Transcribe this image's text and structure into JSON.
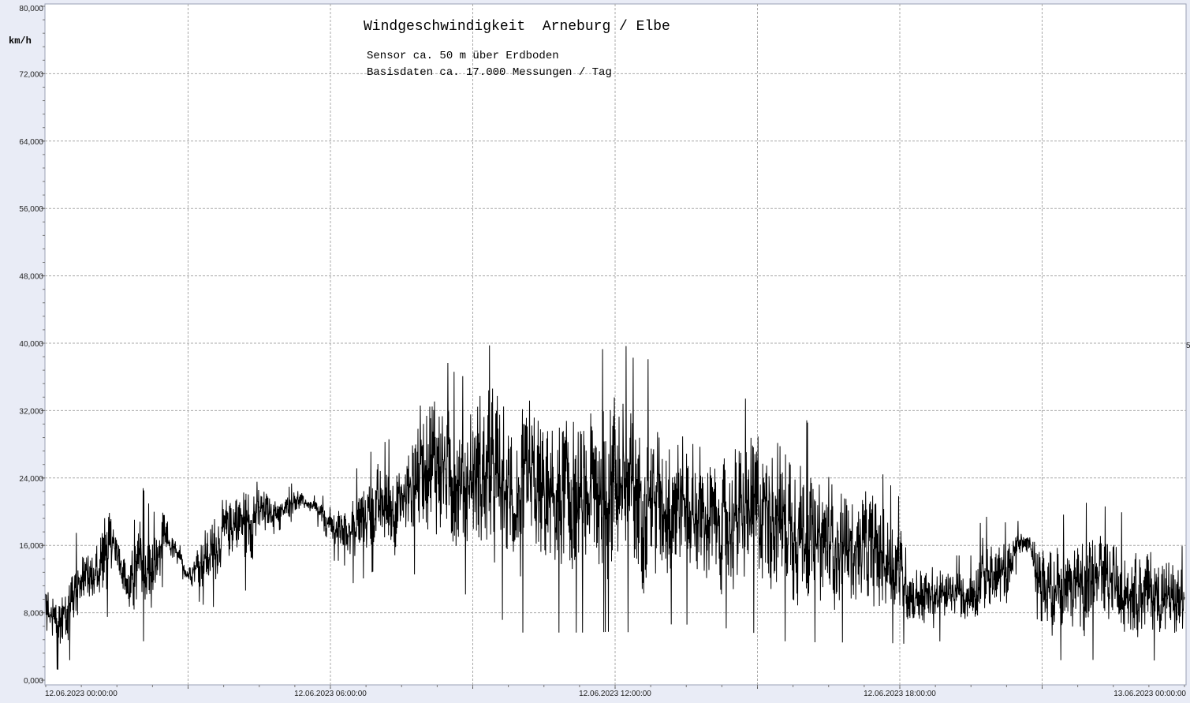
{
  "chart_data": {
    "type": "line",
    "title": "Windgeschwindigkeit  Arneburg / Elbe",
    "subtitle_lines": [
      "Sensor ca. 50 m über Erdboden",
      "Basisdaten ca. 17.000 Messungen / Tag"
    ],
    "ylabel": "km/h",
    "right_edge_label": "5",
    "ylim": [
      0,
      80
    ],
    "y_ticks": [
      {
        "value": 0,
        "label": "0,000"
      },
      {
        "value": 8,
        "label": "8,000"
      },
      {
        "value": 16,
        "label": "16,000"
      },
      {
        "value": 24,
        "label": "24,000"
      },
      {
        "value": 32,
        "label": "32,000"
      },
      {
        "value": 40,
        "label": "40,000"
      },
      {
        "value": 48,
        "label": "48,000"
      },
      {
        "value": 56,
        "label": "56,000"
      },
      {
        "value": 64,
        "label": "64,000"
      },
      {
        "value": 72,
        "label": "72,000"
      },
      {
        "value": 80,
        "label": "80,000"
      }
    ],
    "x_range_hours": [
      0,
      24
    ],
    "x_ticks": [
      {
        "hour": 0,
        "label": "12.06.2023  00:00:00"
      },
      {
        "hour": 6,
        "label": "12.06.2023  06:00:00"
      },
      {
        "hour": 12,
        "label": "12.06.2023  12:00:00"
      },
      {
        "hour": 18,
        "label": "12.06.2023  18:00:00"
      },
      {
        "hour": 24,
        "label": "13.06.2023  00:00:00"
      }
    ],
    "grid": true,
    "series": [
      {
        "color": "#000000",
        "envelope": {
          "x_hours": [
            0,
            0.25,
            0.5,
            0.75,
            1.0,
            1.25,
            1.5,
            1.75,
            2.0,
            2.25,
            2.5,
            2.75,
            3.0,
            3.25,
            3.5,
            3.75,
            4.0,
            4.25,
            4.5,
            4.75,
            5.0,
            5.25,
            5.5,
            5.75,
            6.0,
            6.25,
            6.5,
            6.75,
            7.0,
            7.25,
            7.5,
            7.75,
            8.0,
            8.25,
            8.5,
            8.75,
            9.0,
            9.25,
            9.5,
            9.75,
            10.0,
            10.25,
            10.5,
            10.75,
            11.0,
            11.25,
            11.5,
            11.75,
            12.0,
            12.25,
            12.5,
            12.75,
            13.0,
            13.25,
            13.5,
            13.75,
            14.0,
            14.25,
            14.5,
            14.75,
            15.0,
            15.25,
            15.5,
            15.75,
            16.0,
            16.25,
            16.5,
            16.75,
            17.0,
            17.25,
            17.5,
            17.75,
            18.0,
            18.25,
            18.5,
            18.75,
            19.0,
            19.25,
            19.5,
            19.75,
            20.0,
            20.25,
            20.5,
            20.75,
            21.0,
            21.25,
            21.5,
            21.75,
            22.0,
            22.25,
            22.5,
            22.75,
            23.0,
            23.25,
            23.5,
            23.75,
            24.0
          ],
          "min": [
            2,
            1,
            2,
            6,
            7,
            6,
            12,
            6,
            4,
            5,
            12,
            13,
            11,
            9,
            8,
            11,
            12,
            10,
            14,
            17,
            18,
            19,
            20,
            18,
            14,
            14,
            11,
            12,
            13,
            12,
            12,
            12,
            13,
            12,
            11,
            10,
            9,
            8,
            7,
            6,
            5,
            5,
            5,
            5,
            5,
            5,
            5,
            5,
            5,
            5,
            5,
            5,
            6,
            6,
            6,
            6,
            6,
            6,
            5,
            5,
            5,
            5,
            4,
            4,
            4,
            4,
            4,
            4,
            4,
            4,
            4,
            4,
            4,
            4,
            4,
            4,
            5,
            5,
            5,
            5,
            5,
            6,
            14,
            14,
            2,
            2,
            2,
            2,
            2,
            2,
            2,
            2,
            2,
            2,
            2,
            2,
            2
          ],
          "max": [
            14,
            12,
            16,
            19,
            17,
            24,
            20,
            15,
            24,
            20,
            22,
            17,
            14,
            19,
            22,
            24,
            26,
            27,
            26,
            23,
            22,
            24,
            22,
            22,
            22,
            22,
            25,
            27,
            28,
            29,
            30,
            35,
            40,
            40,
            38,
            36,
            40,
            40,
            41,
            38,
            37,
            40,
            38,
            37,
            39,
            36,
            40,
            40,
            45,
            40,
            38,
            39,
            36,
            37,
            36,
            33,
            32,
            30,
            33,
            34,
            36,
            36,
            35,
            33,
            32,
            28,
            29,
            28,
            27,
            27,
            26,
            24,
            22,
            16,
            16,
            16,
            15,
            15,
            15,
            20,
            19,
            19,
            19,
            18,
            20,
            20,
            20,
            20,
            22,
            21,
            21,
            20,
            20,
            19,
            18,
            17,
            16
          ]
        }
      }
    ]
  }
}
